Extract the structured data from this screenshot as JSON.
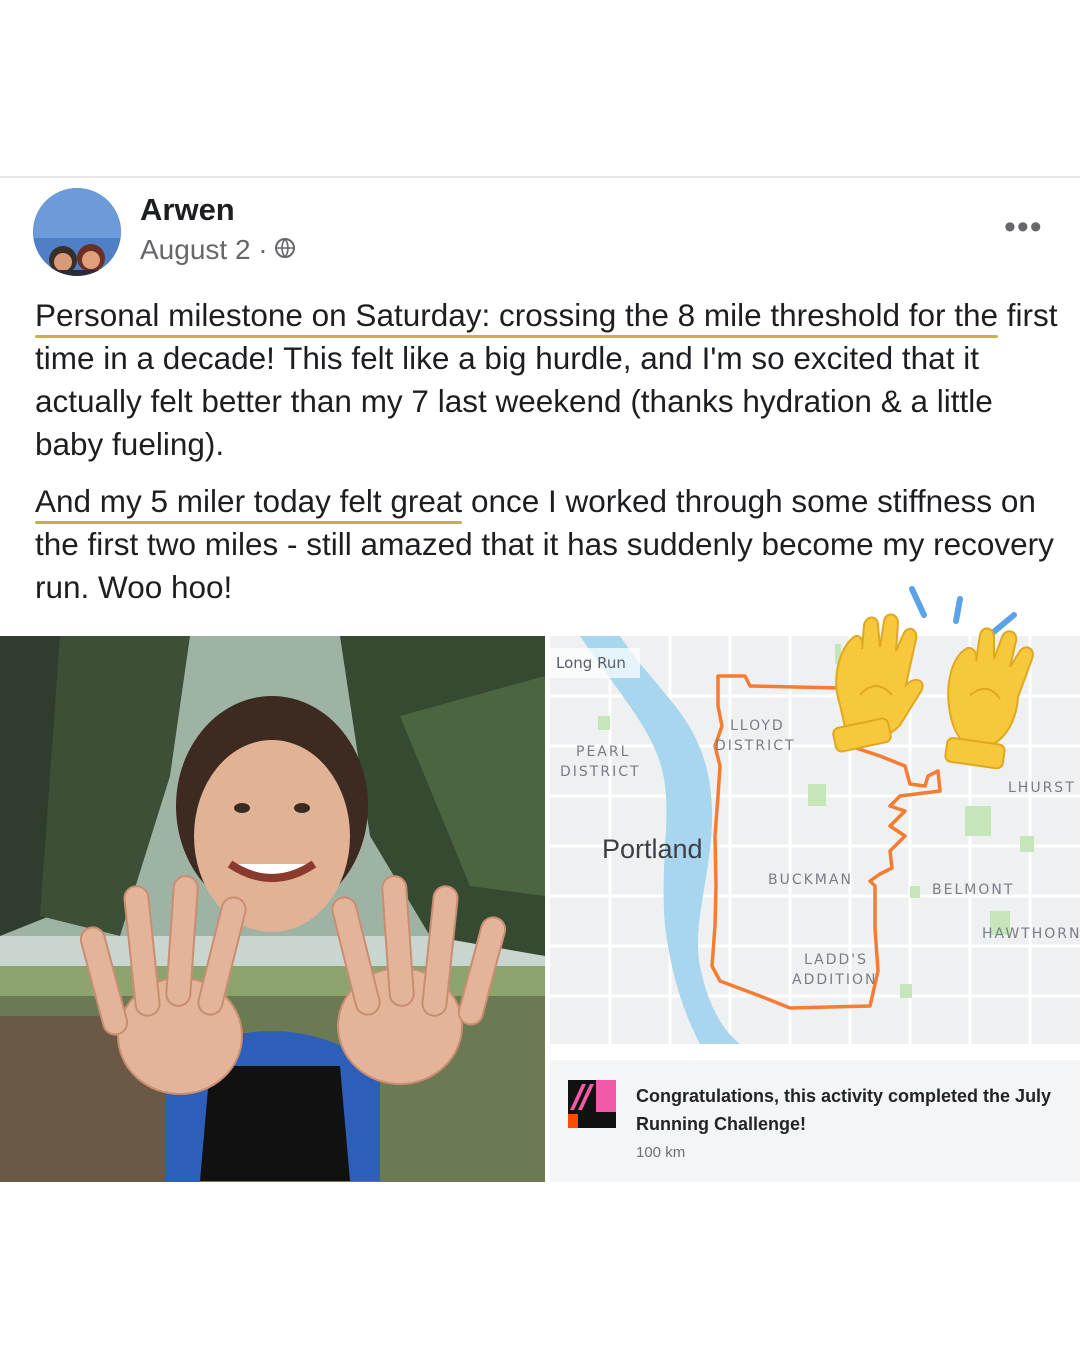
{
  "post": {
    "author": "Arwen",
    "date": "August 2 ·",
    "privacy_icon": "globe-icon",
    "more_icon": "ellipsis-icon",
    "paragraph1": {
      "highlight1": "Personal milestone on Saturday: crossing the 8 mile threshold for the",
      "highlight2": "first time in a decade!",
      "rest": " This felt like a big hurdle, and I'm so excited that it actually felt better than my 7 last weekend (thanks hydration & a little baby fueling)."
    },
    "paragraph2": {
      "highlight": "And my 5 miler today felt great",
      "rest": " once I worked through some stiffness on the first two miles - still amazed that it has suddenly become my recovery run. Woo hoo!"
    },
    "highlight_color": "#c9b040"
  },
  "map": {
    "activity_label": "Long Run",
    "city": "Portland",
    "districts": [
      "PEARL",
      "DISTRICT",
      "LLOYD",
      "DISTRICT",
      "BUCKMAN",
      "BELMONT",
      "HAWTHORN",
      "LADD'S",
      "ADDITION",
      "LHURST"
    ],
    "route_color": "#f57c30",
    "river_color": "#a9d6ef"
  },
  "challenge": {
    "title": "Congratulations, this activity completed the July Running Challenge!",
    "subtitle": "100 km"
  },
  "decor": {
    "hands_icon": "raising-hands-icon"
  }
}
